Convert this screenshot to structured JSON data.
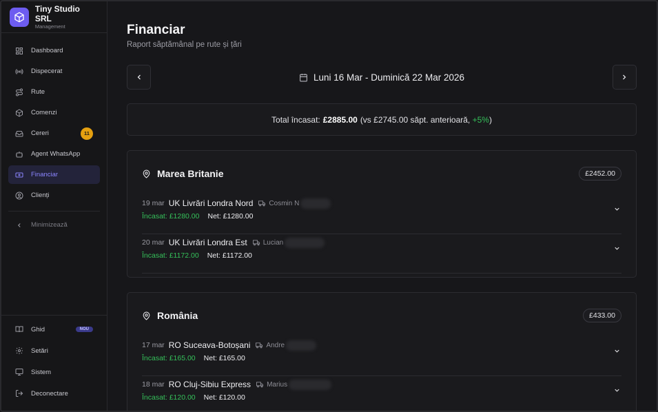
{
  "brand": {
    "name": "Tiny Studio SRL",
    "subtitle": "Management"
  },
  "sidebar": {
    "items": [
      {
        "label": "Dashboard",
        "icon": "grid-icon"
      },
      {
        "label": "Dispecerat",
        "icon": "radio-icon"
      },
      {
        "label": "Rute",
        "icon": "route-icon"
      },
      {
        "label": "Comenzi",
        "icon": "package-icon"
      },
      {
        "label": "Cereri",
        "icon": "inbox-icon",
        "badge": "11"
      },
      {
        "label": "Agent WhatsApp",
        "icon": "bot-icon"
      },
      {
        "label": "Financiar",
        "icon": "banknote-icon",
        "active": true
      },
      {
        "label": "Clienți",
        "icon": "user-circle-icon"
      }
    ],
    "collapse_label": "Minimizează",
    "bottom": [
      {
        "label": "Ghid",
        "icon": "book-icon",
        "badge": "NOU"
      },
      {
        "label": "Setări",
        "icon": "gear-icon"
      },
      {
        "label": "Sistem",
        "icon": "monitor-icon"
      },
      {
        "label": "Deconectare",
        "icon": "logout-icon"
      }
    ]
  },
  "page": {
    "title": "Financiar",
    "subtitle": "Raport săptămânal pe rute și țări",
    "week_label": "Luni 16 Mar - Duminică 22 Mar 2026"
  },
  "total": {
    "prefix": "Total încasat:",
    "amount": "£2885.00",
    "compare": "(vs £2745.00 săpt. anterioară,",
    "change": "+5%",
    "suffix": ")"
  },
  "countries": [
    {
      "name": "Marea Britanie",
      "amount": "£2452.00",
      "routes": [
        {
          "date": "19 mar",
          "name": "UK Livrări Londra Nord",
          "driver": "Cosmin N",
          "income": "Încasat: £1280.00",
          "net": "Net: £1280.00"
        },
        {
          "date": "20 mar",
          "name": "UK Livrări Londra Est",
          "driver": "Lucian",
          "income": "Încasat: £1172.00",
          "net": "Net: £1172.00"
        }
      ]
    },
    {
      "name": "România",
      "amount": "£433.00",
      "routes": [
        {
          "date": "17 mar",
          "name": "RO Suceava-Botoșani",
          "driver": "Andre",
          "income": "Încasat: £165.00",
          "net": "Net: £165.00"
        },
        {
          "date": "18 mar",
          "name": "RO Cluj-Sibiu Express",
          "driver": "Marius",
          "income": "Încasat: £120.00",
          "net": "Net: £120.00"
        }
      ]
    }
  ],
  "colors": {
    "accent": "#6d5cf0",
    "positive": "#35c15a",
    "badge": "#e5a010"
  }
}
